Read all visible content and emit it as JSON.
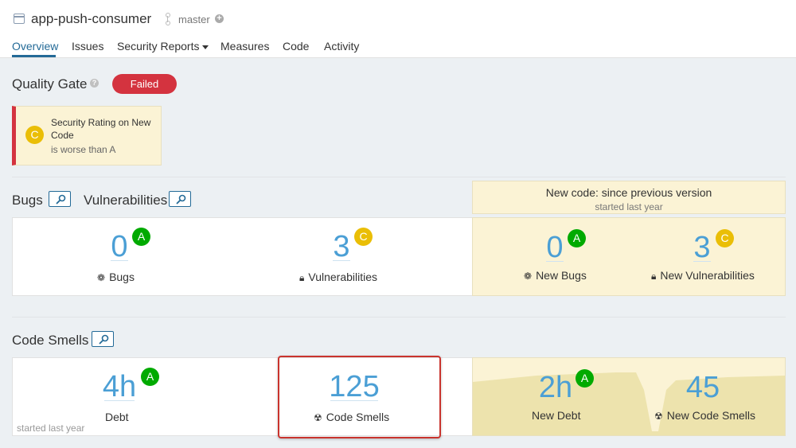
{
  "header": {
    "project_name": "app-push-consumer",
    "branch": "master",
    "branch_icon": "branch-icon",
    "project_icon": "project-icon",
    "add_icon": "plus-circle-icon"
  },
  "nav": {
    "tabs": [
      {
        "label": "Overview",
        "active": true
      },
      {
        "label": "Issues"
      },
      {
        "label": "Security Reports"
      },
      {
        "label": "Measures"
      },
      {
        "label": "Code"
      },
      {
        "label": "Activity"
      }
    ]
  },
  "quality_gate": {
    "title": "Quality Gate",
    "status": "Failed",
    "status_color": "#d4333f",
    "condition": {
      "rating": "C",
      "metric": "Security Rating on New Code",
      "detail": "is worse than A"
    }
  },
  "bugs_vulns": {
    "bugs_title": "Bugs",
    "vulns_title": "Vulnerabilities",
    "new_code": {
      "title": "New code: since previous version",
      "subtitle": "started last year"
    },
    "bugs": {
      "value": "0",
      "rating": "A",
      "label": "Bugs"
    },
    "vulnerabilities": {
      "value": "3",
      "rating": "C",
      "label": "Vulnerabilities"
    },
    "new_bugs": {
      "value": "0",
      "rating": "A",
      "label": "New Bugs"
    },
    "new_vulnerabilities": {
      "value": "3",
      "rating": "C",
      "label": "New Vulnerabilities"
    }
  },
  "code_smells": {
    "title": "Code Smells",
    "debt": {
      "value": "4h",
      "rating": "A",
      "label": "Debt"
    },
    "smells": {
      "value": "125",
      "label": "Code Smells"
    },
    "new_debt": {
      "value": "2h",
      "rating": "A",
      "label": "New Debt"
    },
    "new_smells": {
      "value": "45",
      "label": "New Code Smells"
    },
    "started": "started last year"
  },
  "colors": {
    "accent": "#236a97",
    "rating_a": "#00aa00",
    "rating_c": "#eabe06",
    "new_code_bg": "#fbf3d5"
  }
}
